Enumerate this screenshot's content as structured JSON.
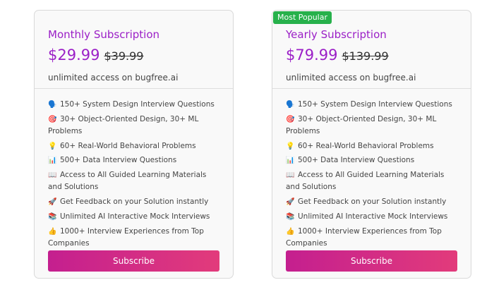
{
  "plans": [
    {
      "title": "Monthly Subscription",
      "price": "$29.99",
      "original_price": "$39.99",
      "subtitle": "unlimited access on bugfree.ai",
      "button": "Subscribe",
      "features": [
        {
          "icon": "🗣️",
          "icon_name": "speaking-head-icon",
          "text": "150+ System Design Interview Questions"
        },
        {
          "icon": "🎯",
          "icon_name": "target-icon",
          "text": "30+ Object-Oriented Design, 30+ ML Problems"
        },
        {
          "icon": "💡",
          "icon_name": "lightbulb-icon",
          "text": "60+ Real-World Behavioral Problems"
        },
        {
          "icon": "📊",
          "icon_name": "bar-chart-icon",
          "text": "500+ Data Interview Questions"
        },
        {
          "icon": "📖",
          "icon_name": "book-icon",
          "text": "Access to All Guided Learning Materials and Solutions"
        },
        {
          "icon": "🚀",
          "icon_name": "rocket-icon",
          "text": "Get Feedback on your Solution instantly"
        },
        {
          "icon": "📚",
          "icon_name": "books-icon",
          "text": "Unlimited AI Interactive Mock Interviews"
        },
        {
          "icon": "👍",
          "icon_name": "thumbs-up-icon",
          "text": "1000+ Interview Experiences from Top Companies"
        }
      ]
    },
    {
      "title": "Yearly Subscription",
      "badge": "Most Popular",
      "price": "$79.99",
      "original_price": "$139.99",
      "subtitle": "unlimited access on bugfree.ai",
      "button": "Subscribe",
      "features": [
        {
          "icon": "🗣️",
          "icon_name": "speaking-head-icon",
          "text": "150+ System Design Interview Questions"
        },
        {
          "icon": "🎯",
          "icon_name": "target-icon",
          "text": "30+ Object-Oriented Design, 30+ ML Problems"
        },
        {
          "icon": "💡",
          "icon_name": "lightbulb-icon",
          "text": "60+ Real-World Behavioral Problems"
        },
        {
          "icon": "📊",
          "icon_name": "bar-chart-icon",
          "text": "500+ Data Interview Questions"
        },
        {
          "icon": "📖",
          "icon_name": "book-icon",
          "text": "Access to All Guided Learning Materials and Solutions"
        },
        {
          "icon": "🚀",
          "icon_name": "rocket-icon",
          "text": "Get Feedback on your Solution instantly"
        },
        {
          "icon": "📚",
          "icon_name": "books-icon",
          "text": "Unlimited AI Interactive Mock Interviews"
        },
        {
          "icon": "👍",
          "icon_name": "thumbs-up-icon",
          "text": "1000+ Interview Experiences from Top Companies"
        }
      ]
    }
  ],
  "colors": {
    "accent_purple": "#9b1fc7",
    "badge_green": "#27b14b",
    "button_start": "#c41f8f",
    "button_end": "#e23b7b"
  }
}
